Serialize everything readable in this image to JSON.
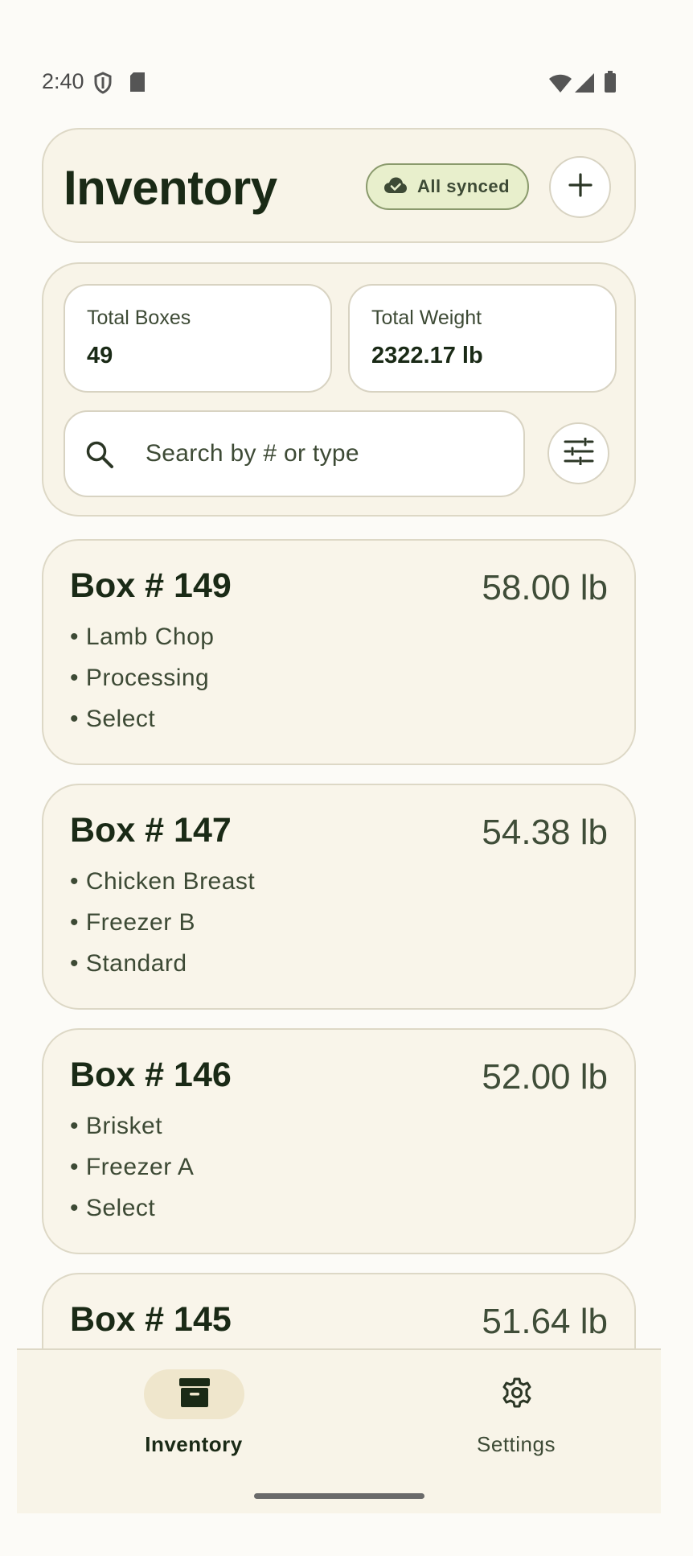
{
  "status_bar": {
    "time": "2:40",
    "icons": [
      "shield-icon",
      "sd-card-icon",
      "wifi-icon",
      "cell-signal-icon",
      "battery-icon"
    ]
  },
  "header": {
    "title": "Inventory",
    "sync_chip": {
      "icon": "cloud-check-icon",
      "label": "All synced"
    },
    "add_button_icon": "plus-icon"
  },
  "summary": {
    "total_boxes": {
      "label": "Total Boxes",
      "value": "49"
    },
    "total_weight": {
      "label": "Total Weight",
      "value": "2322.17 lb"
    }
  },
  "search": {
    "icon": "search-icon",
    "placeholder": "Search by # or type",
    "value": "",
    "filter_icon": "tune-icon"
  },
  "boxes": [
    {
      "number": "Box # 149",
      "weight": "58.00 lb",
      "details": [
        "• Lamb Chop",
        "• Processing",
        "• Select"
      ]
    },
    {
      "number": "Box # 147",
      "weight": "54.38 lb",
      "details": [
        "• Chicken Breast",
        "• Freezer B",
        "• Standard"
      ]
    },
    {
      "number": "Box # 146",
      "weight": "52.00 lb",
      "details": [
        "• Brisket",
        "• Freezer A",
        "• Select"
      ]
    },
    {
      "number": "Box # 145",
      "weight": "51.64 lb",
      "details": []
    }
  ],
  "bottom_nav": {
    "items": [
      {
        "label": "Inventory",
        "icon": "archive-box-icon",
        "active": true
      },
      {
        "label": "Settings",
        "icon": "gear-icon",
        "active": false
      }
    ]
  },
  "colors": {
    "background": "#fcfbf7",
    "card": "#f8f4e8",
    "text_primary": "#1a2a16",
    "text_secondary": "#3d4a35",
    "sync_chip_bg": "#e8efcc",
    "nav_active_pill": "#efe6cc"
  }
}
